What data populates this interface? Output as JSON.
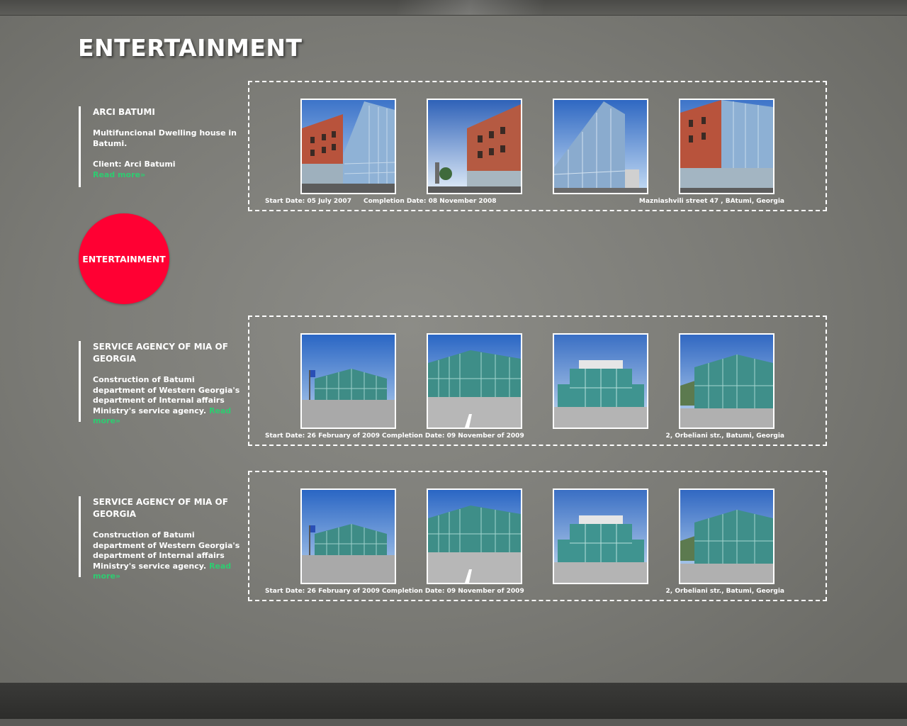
{
  "page": {
    "title": "ENTERTAINMENT",
    "category_badge": "ENTERTAINMENT"
  },
  "projects": [
    {
      "title": "ARCI BATUMI",
      "description": "Multifuncional Dwelling house in Batumi.",
      "client": "Client: Arci Batumi",
      "read_more": "Read more»",
      "start_date": "Start Date: 05 July 2007",
      "completion_date": "Completion Date: 08 November 2008",
      "address": "Mazniashvili street 47 , BAtumi, Georgia",
      "images": [
        "brick-glass-building-photo",
        "brick-building-street-photo",
        "glass-facade-photo",
        "brick-glass-corner-photo"
      ]
    },
    {
      "title": "SERVICE AGENCY OF MIA OF GEORGIA",
      "description": "Construction of Batumi department of Western Georgia's department of Internal affairs Ministry's service agency.",
      "read_more": "Read more»",
      "start_date": "Start Date: 26 February of 2009",
      "completion_date": "Completion Date: 09 November  of 2009",
      "address": "2, Orbeliani str., Batumi, Georgia",
      "images": [
        "glass-office-flags-photo",
        "glass-office-angle-photo",
        "glass-office-front-photo",
        "glass-office-corner-photo"
      ]
    },
    {
      "title": "SERVICE AGENCY OF MIA OF GEORGIA",
      "description": "Construction of Batumi department of Western Georgia's department of Internal affairs Ministry's service agency.",
      "read_more": "Read more»",
      "start_date": "Start Date: 26 February of 2009",
      "completion_date": "Completion Date: 09 November  of 2009",
      "address": "2, Orbeliani str., Batumi, Georgia",
      "images": [
        "glass-office-flags-photo",
        "glass-office-angle-photo",
        "glass-office-front-photo",
        "glass-office-corner-photo"
      ]
    }
  ],
  "colors": {
    "accent_red": "#ff0033",
    "link_green": "#2ecc71",
    "text_white": "#ffffff"
  }
}
